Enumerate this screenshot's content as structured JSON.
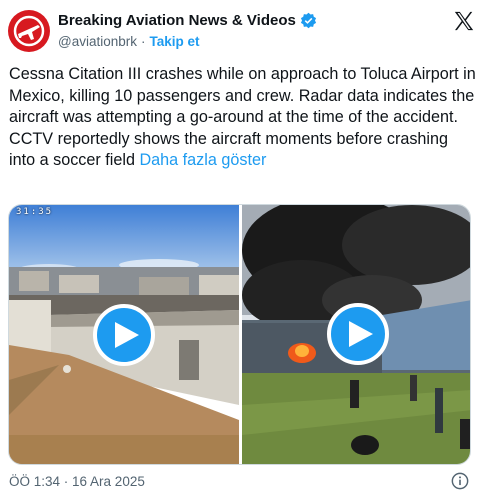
{
  "account": {
    "display_name": "Breaking Aviation News & Videos",
    "handle": "@aviationbrk",
    "separator": "·",
    "follow_label": "Takip et",
    "verified_color": "#1d9bf0",
    "avatar_color": "#d71920"
  },
  "tweet": {
    "text": "Cessna Citation III crashes while on approach to Toluca Airport in Mexico, killing 10 passengers and crew. Radar data indicates the aircraft was attempting a go-around at the time of the accident. CCTV reportedly shows the aircraft moments before crashing into a soccer field ",
    "show_more_label": "Daha fazla göster"
  },
  "media": {
    "left_video": {
      "overlay_time": "31:35",
      "icon": "play-icon"
    },
    "right_video": {
      "icon": "play-icon"
    }
  },
  "footer": {
    "timestamp": "ÖÖ 1:34 · 16 Ara 2025",
    "info_icon": "info-icon"
  },
  "colors": {
    "accent": "#1d9bf0",
    "text": "#0f1419",
    "muted": "#536471"
  }
}
